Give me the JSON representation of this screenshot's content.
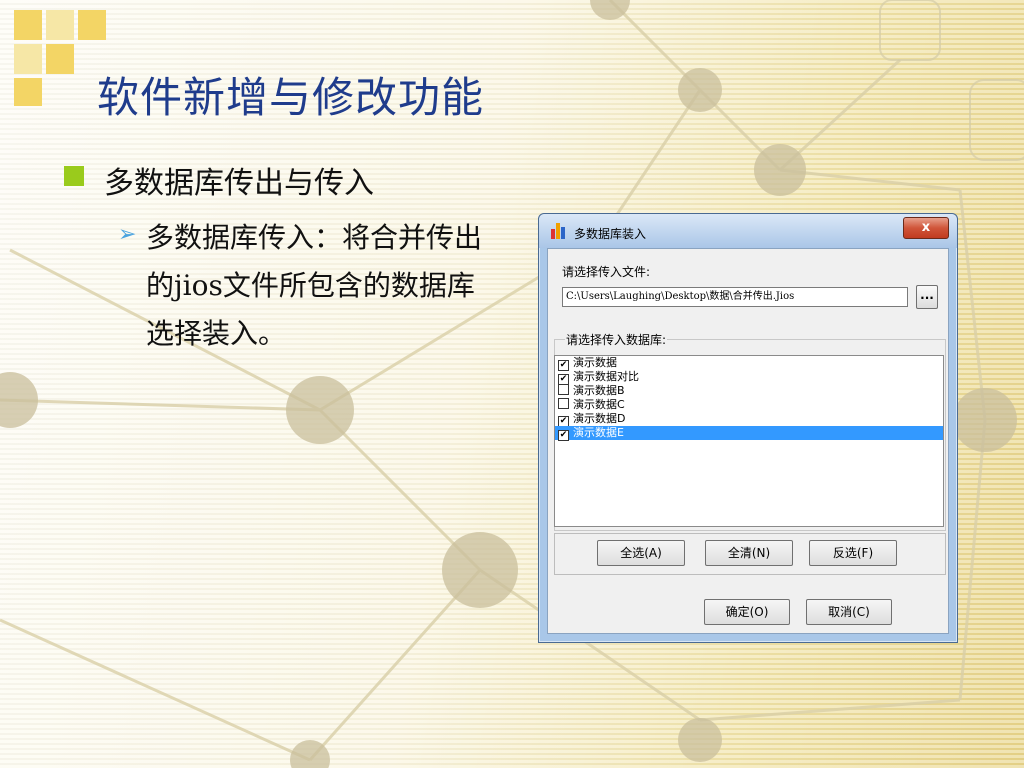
{
  "slide": {
    "title": "软件新增与修改功能",
    "bullet1": "多数据库传出与传入",
    "bullet2": "多数据库传入：将合并传出的jios文件所包含的数据库选择装入。"
  },
  "dialog": {
    "title": "多数据库装入",
    "close_label": "x",
    "file_label": "请选择传入文件:",
    "file_path": "C:\\Users\\Laughing\\Desktop\\数据\\合并传出.Jios",
    "browse_label": "...",
    "db_group_label": "请选择传入数据库:",
    "databases": [
      {
        "name": "演示数据",
        "checked": true,
        "selected": false
      },
      {
        "name": "演示数据对比",
        "checked": true,
        "selected": false
      },
      {
        "name": "演示数据B",
        "checked": false,
        "selected": false
      },
      {
        "name": "演示数据C",
        "checked": false,
        "selected": false
      },
      {
        "name": "演示数据D",
        "checked": true,
        "selected": false
      },
      {
        "name": "演示数据E",
        "checked": true,
        "selected": true
      }
    ],
    "buttons": {
      "select_all": "全选(A)",
      "clear_all": "全清(N)",
      "invert": "反选(F)",
      "ok": "确定(O)",
      "cancel": "取消(C)"
    }
  },
  "colors": {
    "title": "#1f3c8c",
    "bullet_square": "#9acb1c",
    "bullet_arrow": "#4aa3df",
    "selection": "#3399ff"
  }
}
